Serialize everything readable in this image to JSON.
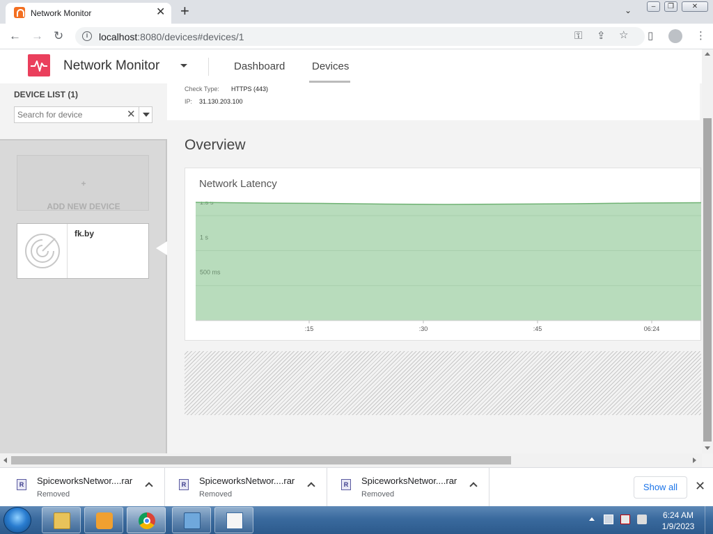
{
  "browser": {
    "tab_title": "Network Monitor",
    "new_tab": "+",
    "url_host": "localhost",
    "url_rest": ":8080/devices#devices/1"
  },
  "app": {
    "brand": "Network Monitor",
    "nav": [
      {
        "label": "Dashboard",
        "active": false
      },
      {
        "label": "Devices",
        "active": true
      }
    ],
    "accent_color": "#ea3f5c"
  },
  "sidebar": {
    "title": "DEVICE LIST",
    "count": "(1)",
    "search_placeholder": "Search for device",
    "add_device_label": "ADD NEW DEVICE",
    "devices": [
      {
        "name": "fk.by",
        "icon": "radar-icon"
      }
    ]
  },
  "device_info": {
    "check_type_label": "Check Type:",
    "check_type_value": "HTTPS (443)",
    "ip_label": "IP:",
    "ip_value": "31.130.203.100"
  },
  "overview": {
    "heading": "Overview"
  },
  "chart_data": {
    "type": "area",
    "title": "Network Latency",
    "y_ticks": [
      "500 ms",
      "1 s",
      "1.5 s"
    ],
    "y_tick_values": [
      500,
      1000,
      1500
    ],
    "x_ticks": [
      ":15",
      ":30",
      ":45",
      "06:24"
    ],
    "ylim": [
      0,
      1700
    ],
    "x": [
      0,
      1,
      2,
      3,
      4,
      5,
      6,
      7,
      8
    ],
    "values": [
      1690,
      1680,
      1675,
      1665,
      1660,
      1665,
      1670,
      1680,
      1685
    ],
    "fill_color": "#b8dcbc",
    "line_color": "#6fb273",
    "grid": true
  },
  "downloads": {
    "items": [
      {
        "filename": "SpiceworksNetwor....rar",
        "status": "Removed"
      },
      {
        "filename": "SpiceworksNetwor....rar",
        "status": "Removed"
      },
      {
        "filename": "SpiceworksNetwor....rar",
        "status": "Removed"
      }
    ],
    "show_all": "Show all"
  },
  "taskbar": {
    "time": "6:24 AM",
    "date": "1/9/2023"
  }
}
